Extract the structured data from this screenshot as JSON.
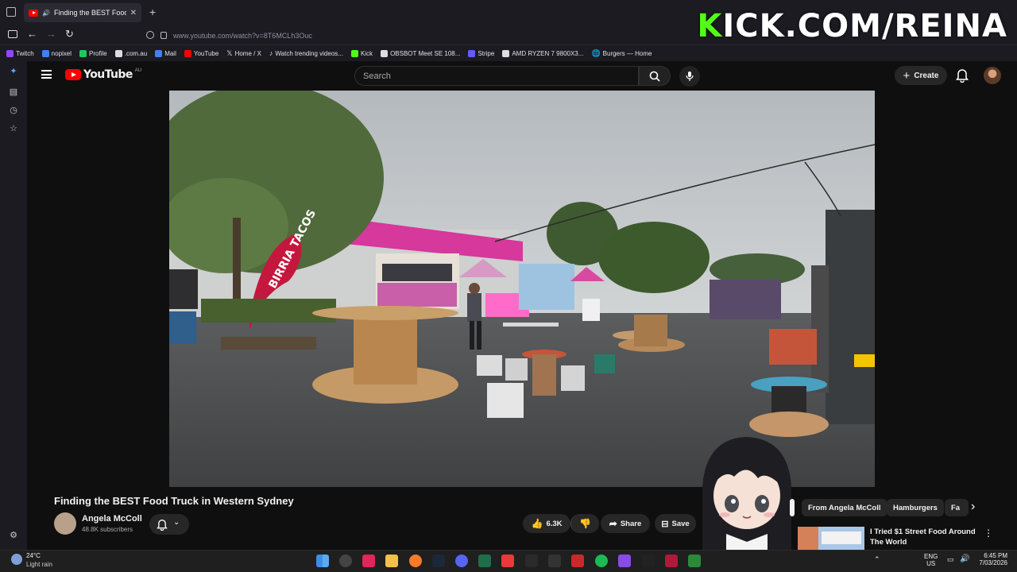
{
  "browser": {
    "tab_title": "Finding the BEST Food Truck",
    "url": "www.youtube.com/watch?v=8T6MCLh3Ouc",
    "bookmarks": [
      "Twitch",
      "nopixel",
      "Profile",
      ".com.au",
      "Mail",
      "YouTube",
      "Home / X",
      "Watch trending videos...",
      "Kick",
      "OBSBOT Meet SE 108...",
      "Stripe",
      "AMD RYZEN 7 9800X3...",
      "Burgers — Home"
    ]
  },
  "overlay": {
    "prefix": "K",
    "text": "ICK.COM/REINA"
  },
  "youtube": {
    "logo": "YouTube",
    "region": "AU",
    "search_placeholder": "Search",
    "create_label": "Create"
  },
  "video": {
    "title": "Finding the BEST Food Truck in Western Sydney",
    "channel": "Angela McColl",
    "subscribers": "48.8K subscribers",
    "likes": "6.3K",
    "share_label": "Share",
    "save_label": "Save",
    "scene_sign": "BIRRIA TACOS"
  },
  "chips": [
    "From Angela McColl",
    "Hamburgers",
    "Fa"
  ],
  "recommended": {
    "title": "I Tried $1 Street Food Around The World"
  },
  "taskbar": {
    "temp": "24°C",
    "weather": "Light rain",
    "lang": "ENG",
    "region": "US",
    "time": "6:45 PM",
    "date": "7/03/2026"
  },
  "colors": {
    "yt_red": "#ff0000",
    "kick_green": "#53fc18",
    "bg": "#0f0f0f"
  }
}
